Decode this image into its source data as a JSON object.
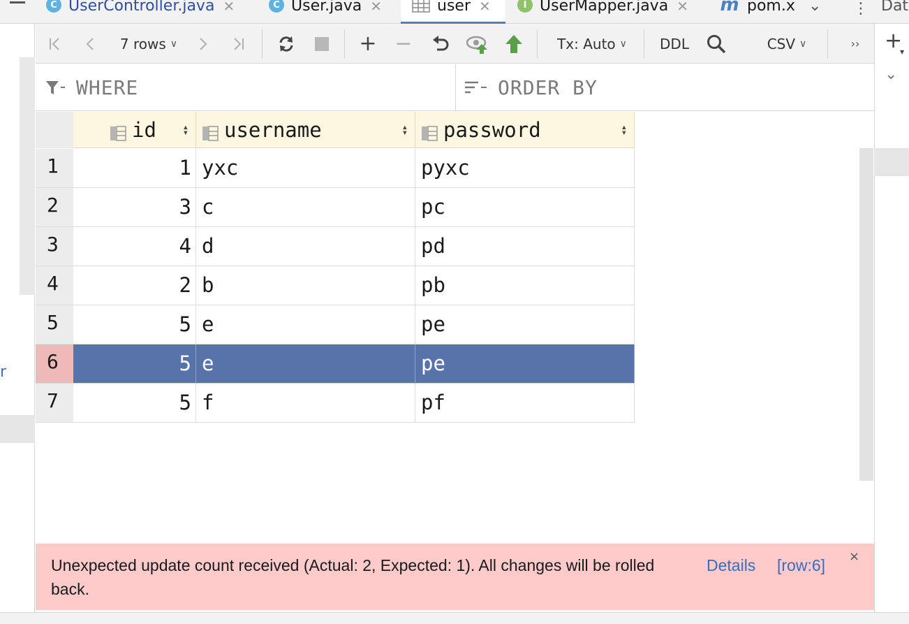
{
  "colors": {
    "accent": "#4a82c3",
    "selected_row": "#5873aa",
    "selected_rownum": "#f0b9b9",
    "error_bg": "#fecaca",
    "header_bg": "#fdf7e1",
    "link": "#3a6dbc"
  },
  "left_partial_text": "r",
  "tabs": [
    {
      "label": "UserController.java",
      "icon": "class-icon",
      "icon_glyph": "C"
    },
    {
      "label": "User.java",
      "icon": "class-icon",
      "icon_glyph": "C"
    },
    {
      "label": "user",
      "icon": "table-icon",
      "active": true
    },
    {
      "label": "UserMapper.java",
      "icon": "interface-icon",
      "icon_glyph": "I"
    },
    {
      "label": "pom.x",
      "icon": "maven-icon",
      "icon_glyph": "m"
    }
  ],
  "right_panel_label": "Dat",
  "toolbar": {
    "rows_label": "7 rows",
    "tx_label": "Tx: Auto",
    "ddl_label": "DDL",
    "csv_label": "CSV"
  },
  "filter": {
    "where_label": "WHERE",
    "order_label": "ORDER BY"
  },
  "table": {
    "columns": [
      "id",
      "username",
      "password"
    ],
    "rows": [
      {
        "num": "1",
        "id": "1",
        "username": "yxc",
        "password": "pyxc"
      },
      {
        "num": "2",
        "id": "3",
        "username": "c",
        "password": "pc"
      },
      {
        "num": "3",
        "id": "4",
        "username": "d",
        "password": "pd"
      },
      {
        "num": "4",
        "id": "2",
        "username": "b",
        "password": "pb"
      },
      {
        "num": "5",
        "id": "5",
        "username": "e",
        "password": "pe"
      },
      {
        "num": "6",
        "id": "5",
        "username": "e",
        "password": "pe",
        "selected": true
      },
      {
        "num": "7",
        "id": "5",
        "username": "f",
        "password": "pf"
      }
    ]
  },
  "error": {
    "message": "Unexpected update count received (Actual: 2, Expected: 1). All changes will be rolled back.",
    "details_link": "Details",
    "row_link": "[row:6]",
    "close_glyph": "×"
  }
}
